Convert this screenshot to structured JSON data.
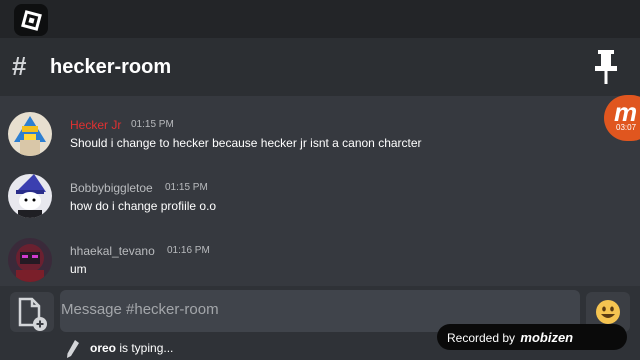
{
  "header": {
    "hash": "#",
    "title": "hecker-room"
  },
  "messages": [
    {
      "author": "Hecker Jr",
      "author_color": "#e03131",
      "time": "01:15 PM",
      "text": "Should i change to hecker because hecker jr isnt a canon charcter"
    },
    {
      "author": "Bobbybiggletoe",
      "author_color": "#b9bbbe",
      "time": "01:15 PM",
      "text": "how do i change profiile o.o"
    },
    {
      "author": "hhaekal_tevano",
      "author_color": "#b9bbbe",
      "time": "01:16 PM",
      "text": "um"
    }
  ],
  "composer": {
    "placeholder": "Message #hecker-room"
  },
  "typing": {
    "user": "oreo",
    "suffix": " is typing..."
  },
  "recorder": {
    "bubble_letter": "m",
    "bubble_time": "03:07",
    "label": "Recorded by",
    "brand": "mobizen"
  },
  "icons": {
    "menu": "roblox-logo-icon",
    "pin": "pin-icon",
    "attach": "attach-file-icon",
    "emoji": "emoji-icon",
    "typing": "pencil-icon"
  }
}
